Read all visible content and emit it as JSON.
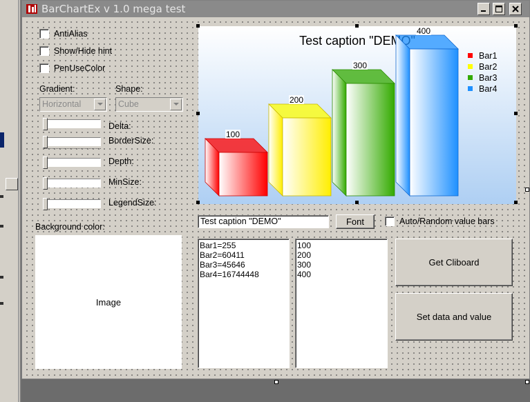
{
  "window": {
    "title": "BarChartEx v 1.0 mega test"
  },
  "options": {
    "antialias_label": "AntiAlias",
    "showhide_label": "Show/Hide hint",
    "penusecolor_label": "PenUseColor"
  },
  "gradient": {
    "label": "Gradient:",
    "value": "Horizontal"
  },
  "shape": {
    "label": "Shape:",
    "value": "Cube"
  },
  "sliders": {
    "delta": "Delta:",
    "bordersize": "BorderSize:",
    "depth": "Depth:",
    "minsize": "MinSize:",
    "legendsize": "LegendSize:"
  },
  "background": {
    "label": "Background color:",
    "image_label": "Image"
  },
  "caption_input": {
    "value": "Test caption \"DEMO\""
  },
  "font_button": "Font",
  "auto_random_label": "Auto/Random value bars",
  "memo_colors": [
    "Bar1=255",
    "Bar2=60411",
    "Bar3=45646",
    "Bar4=16744448"
  ],
  "memo_values": [
    "100",
    "200",
    "300",
    "400"
  ],
  "buttons": {
    "get_clipboard": "Get Cliboard",
    "set_data": "Set data and value"
  },
  "chart_data": {
    "type": "bar",
    "title": "Test caption \"DEMO\"",
    "categories": [
      "Bar1",
      "Bar2",
      "Bar3",
      "Bar4"
    ],
    "values": [
      100,
      200,
      300,
      400
    ],
    "data_labels": [
      "100",
      "200",
      "300",
      "400"
    ],
    "ylim": [
      0,
      400
    ],
    "shape": "cube",
    "legend_position": "top-right",
    "grid": false,
    "colors": [
      "#ff0000",
      "#ffff00",
      "#33aa00",
      "#1e90ff"
    ]
  }
}
